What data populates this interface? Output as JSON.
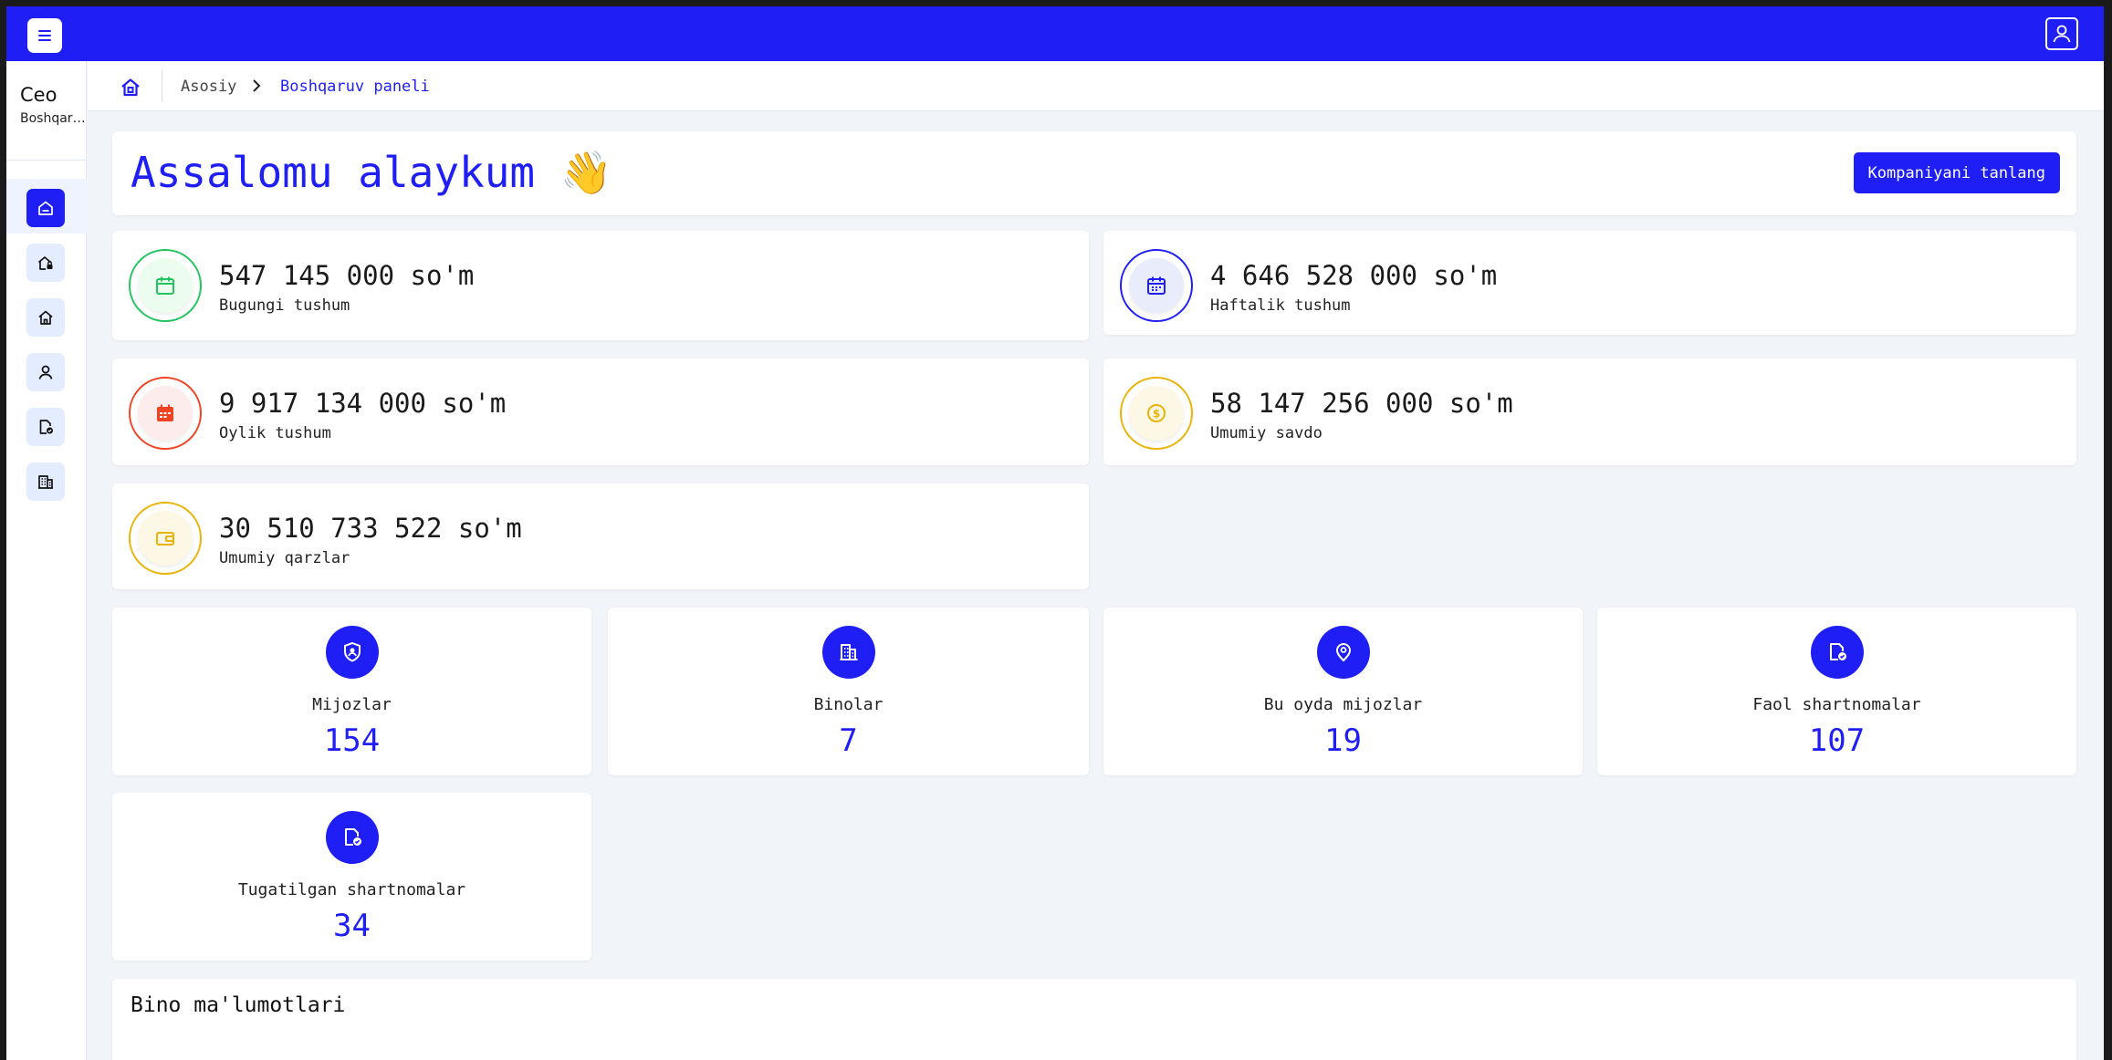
{
  "topbar": {
    "menu_icon": "hamburger-icon",
    "user_icon": "user-icon",
    "color": "#1f1ff5"
  },
  "sidebar": {
    "user_name": "Ceo",
    "user_role": "Boshqaruv paneli",
    "items": [
      {
        "icon": "dashboard-icon",
        "active": true
      },
      {
        "icon": "house-lock-icon"
      },
      {
        "icon": "home-icon"
      },
      {
        "icon": "user-icon"
      },
      {
        "icon": "contract-icon"
      },
      {
        "icon": "building-icon"
      }
    ]
  },
  "breadcrumb": {
    "home_icon": "home-icon",
    "items": [
      "Asosiy",
      "Boshqaruv paneli"
    ]
  },
  "greeting": {
    "title": "Assalomu alaykum",
    "emoji": "👋",
    "button": "Kompaniyani tanlang"
  },
  "stats": [
    {
      "value": "547 145 000 so'm",
      "label": "Bugungi tushum",
      "icon": "calendar-icon",
      "color": "#22c55e"
    },
    {
      "value": "4 646 528 000 so'm",
      "label": "Haftalik tushum",
      "icon": "calendar-icon",
      "color": "#1f1ff5"
    },
    {
      "value": "9 917 134 000 so'm",
      "label": "Oylik tushum",
      "icon": "calendar-icon",
      "color": "#ef4423"
    },
    {
      "value": "58 147 256 000 so'm",
      "label": "Umumiy savdo",
      "icon": "coin-icon",
      "color": "#eab308"
    },
    {
      "value": "30 510 733 522 so'm",
      "label": "Umumiy qarzlar",
      "icon": "wallet-icon",
      "color": "#eab308"
    }
  ],
  "counts": [
    {
      "label": "Mijozlar",
      "value": "154",
      "icon": "client-badge-icon"
    },
    {
      "label": "Binolar",
      "value": "7",
      "icon": "building-icon"
    },
    {
      "label": "Bu oyda mijozlar",
      "value": "19",
      "icon": "location-pin-icon"
    },
    {
      "label": "Faol shartnomalar",
      "value": "107",
      "icon": "contract-check-icon"
    },
    {
      "label": "Tugatilgan shartnomalar",
      "value": "34",
      "icon": "contract-check-icon"
    }
  ],
  "bino": {
    "title": "Bino ma'lumotlari"
  }
}
